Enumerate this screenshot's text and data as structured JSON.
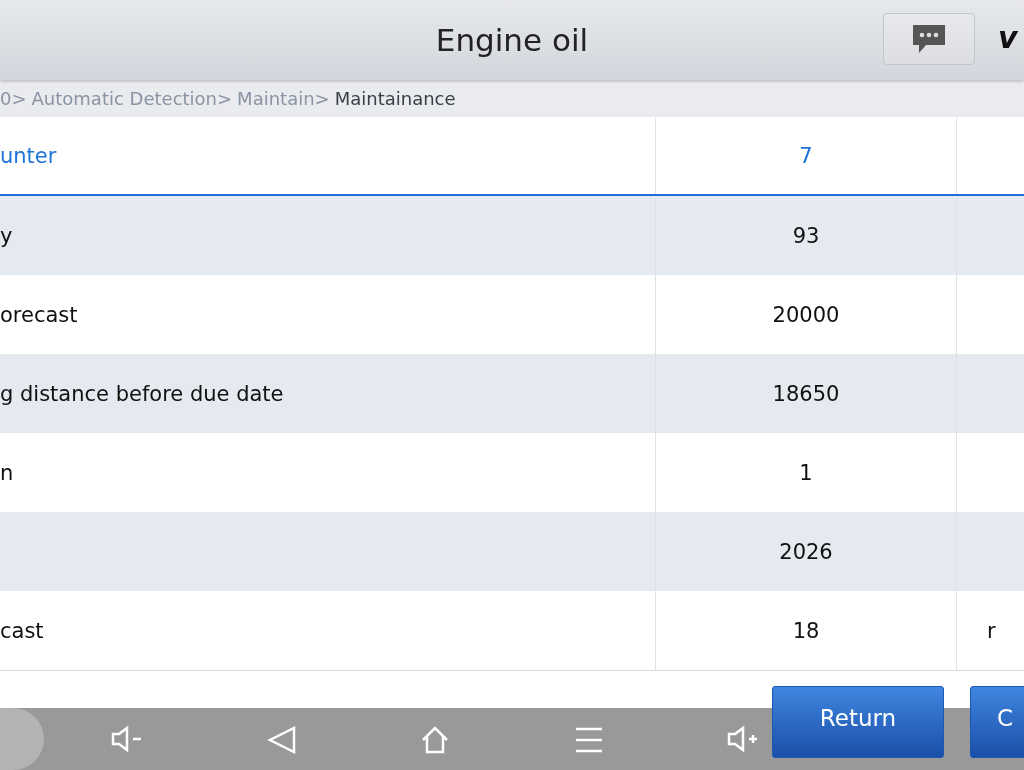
{
  "title_bar": {
    "title": "Engine oil",
    "logo_text": "v"
  },
  "breadcrumb": [
    {
      "label": "0>",
      "current": false
    },
    {
      "label": "Automatic Detection>",
      "current": false
    },
    {
      "label": "Maintain>",
      "current": false
    },
    {
      "label": "Maintainance",
      "current": true
    }
  ],
  "table": {
    "header": {
      "column_1": "unter",
      "column_2": "7"
    },
    "rows": [
      {
        "column_1": "y",
        "column_2": "93"
      },
      {
        "column_1": "orecast",
        "column_2": "20000"
      },
      {
        "column_1": "g distance before due date",
        "column_2": "18650"
      },
      {
        "column_1": "n",
        "column_2": "1"
      },
      {
        "column_2": "2026"
      },
      {
        "column_1": "cast",
        "column_2": "18",
        "column_3": "r"
      }
    ]
  },
  "buttons": [
    "Return",
    "C"
  ]
}
